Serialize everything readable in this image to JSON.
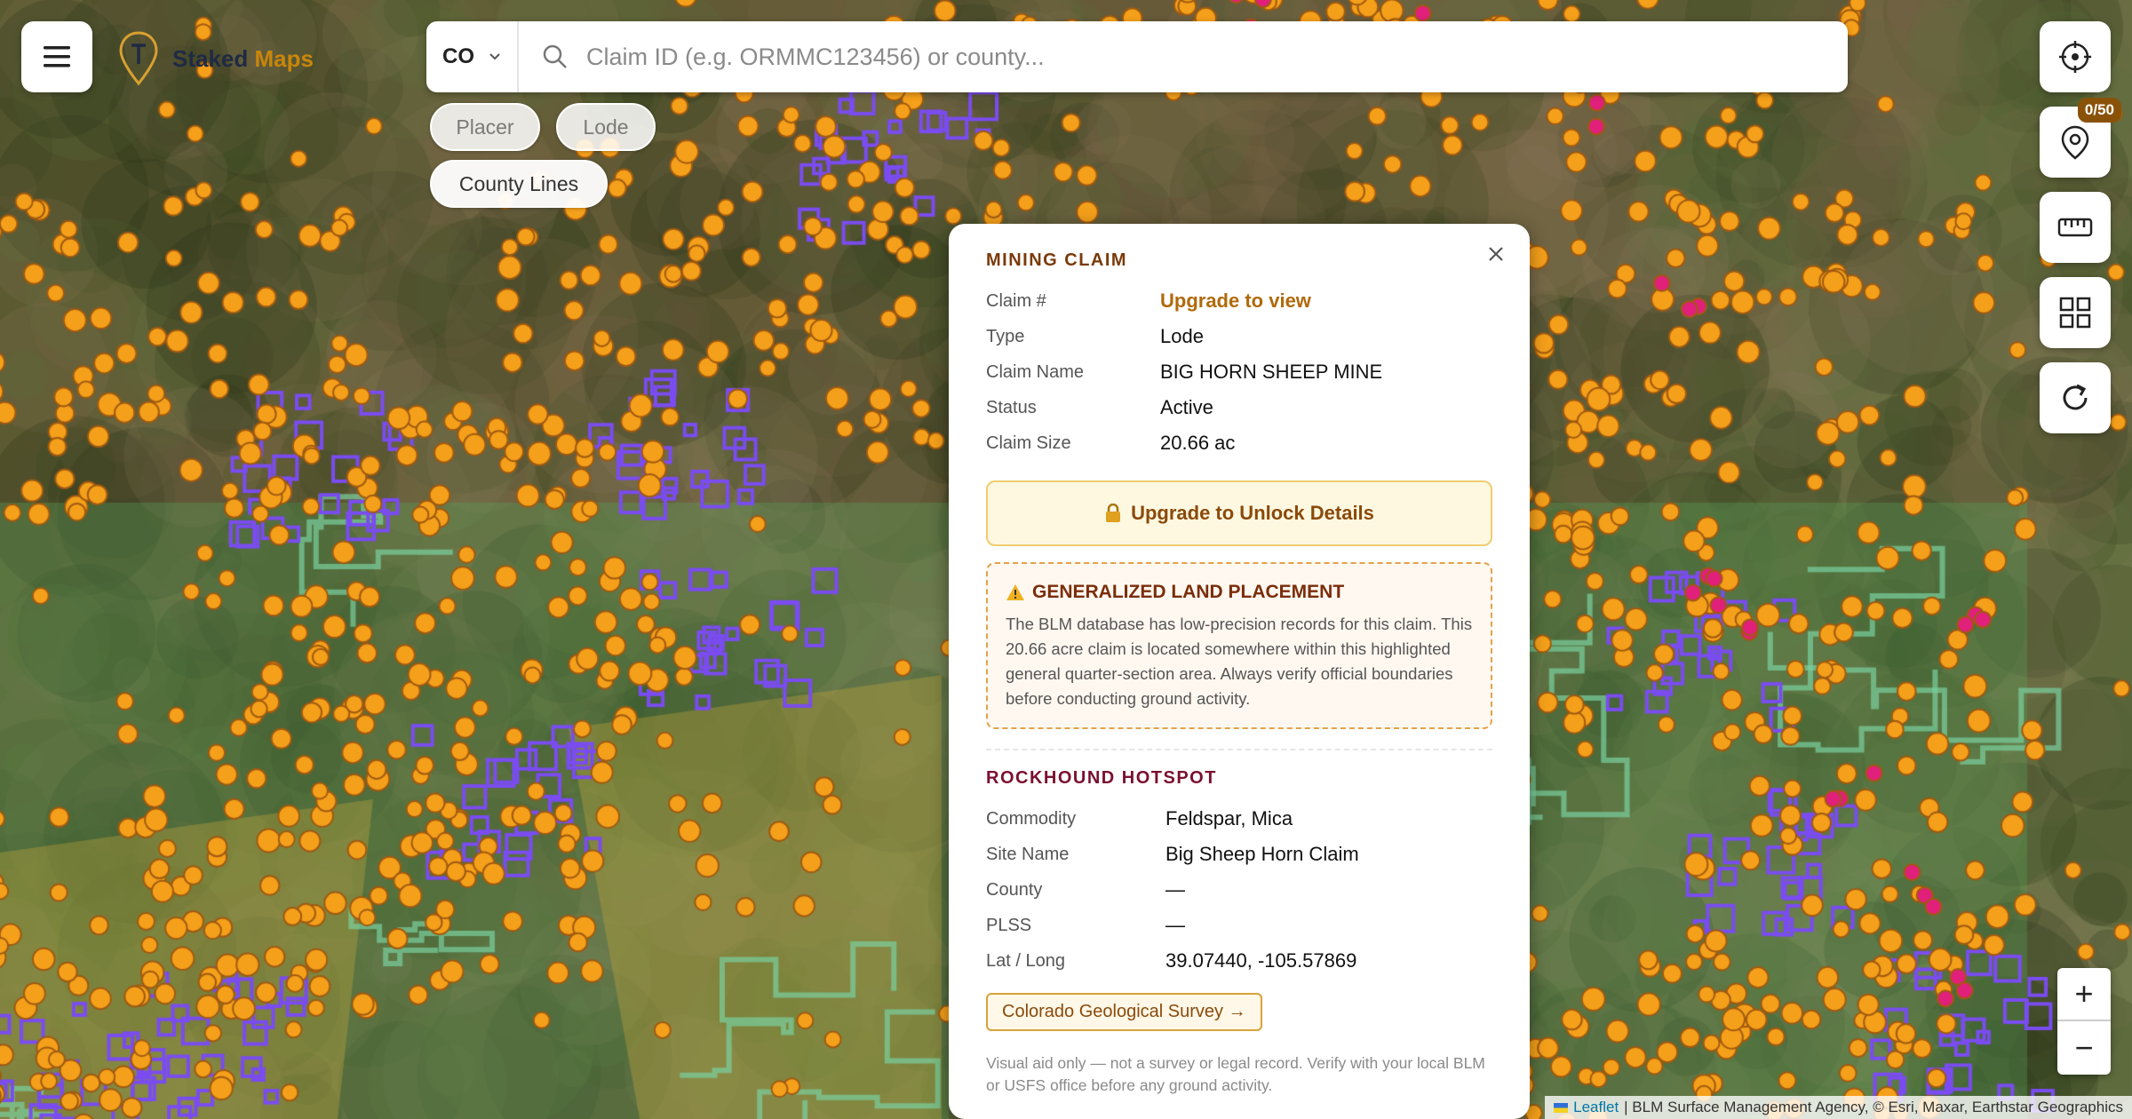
{
  "app": {
    "logo_word1": "Staked",
    "logo_word2": "Maps"
  },
  "search": {
    "state": "CO",
    "placeholder": "Claim ID (e.g. ORMMC123456) or county..."
  },
  "filters": {
    "placer": "Placer",
    "lode": "Lode",
    "county_lines": "County Lines"
  },
  "side_buttons": {
    "claims_badge": "0/50"
  },
  "zoom": {
    "in": "+",
    "out": "−"
  },
  "attribution": {
    "leaflet": "Leaflet",
    "text": "| BLM Surface Management Agency, © Esri, Maxar, Earthstar Geographics"
  },
  "popup": {
    "claim_title": "MINING CLAIM",
    "claim": {
      "claim_no_label": "Claim #",
      "claim_no_value": "Upgrade to view",
      "type_label": "Type",
      "type_value": "Lode",
      "name_label": "Claim Name",
      "name_value": "BIG HORN SHEEP MINE",
      "status_label": "Status",
      "status_value": "Active",
      "size_label": "Claim Size",
      "size_value": "20.66 ac"
    },
    "unlock_label": "Upgrade to Unlock Details",
    "warning": {
      "title": "GENERALIZED LAND PLACEMENT",
      "body": "The BLM database has low-precision records for this claim. This 20.66 acre claim is located somewhere within this highlighted general quarter-section area. Always verify official boundaries before conducting ground activity."
    },
    "hotspot_title": "ROCKHOUND HOTSPOT",
    "hotspot": {
      "commodity_label": "Commodity",
      "commodity_value": "Feldspar, Mica",
      "site_label": "Site Name",
      "site_value": "Big Sheep Horn Claim",
      "county_label": "County",
      "county_value": "—",
      "plss_label": "PLSS",
      "plss_value": "—",
      "latlong_label": "Lat / Long",
      "latlong_value": "39.07440, -105.57869"
    },
    "survey_link": "Colorado Geological Survey →",
    "footnote": "Visual aid only — not a survey or legal record. Verify with your local BLM or USFS office before any ground activity."
  },
  "colors": {
    "claim_marker": "#f5a01a",
    "hotspot_marker": "#e0207a",
    "lode_outline": "#7a4cf0",
    "county_outline": "#7ad0a0",
    "accent": "#c8860a"
  }
}
